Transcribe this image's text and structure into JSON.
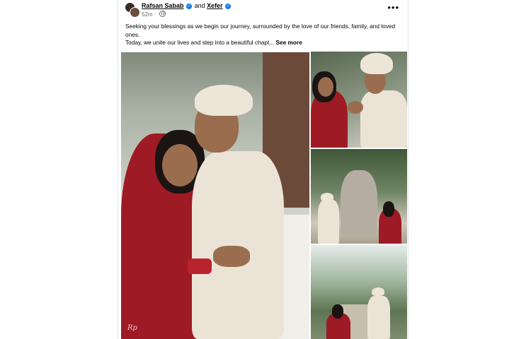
{
  "post": {
    "author": "Rafsan Sabab",
    "connector": "and",
    "coauthor": "Xefer",
    "time": "52m",
    "separator": "·",
    "more_glyph": "•••",
    "icons": {
      "verified": "verified-badge-icon",
      "audience": "globe-icon",
      "more": "more-options-icon"
    },
    "caption_line1": "Seeking your blessings as we begin our journey, surrounded by the love of our friends, family, and loved ones.",
    "caption_line2": "Today, we unite our lives and step into a beautiful chapt...",
    "see_more": "See more"
  },
  "photos": {
    "main": {
      "alt": "Couple in traditional wedding attire embracing",
      "watermark": "Rp"
    },
    "thumbs": [
      {
        "alt": "Groom holding bride's hands"
      },
      {
        "alt": "Couple holding hands by a garden fountain"
      },
      {
        "alt": "Couple walking in a garden"
      }
    ]
  },
  "colors": {
    "link_blue": "#1877f2",
    "bridal_red": "#9e1a24",
    "sherwani_cream": "#ebe4d6"
  }
}
